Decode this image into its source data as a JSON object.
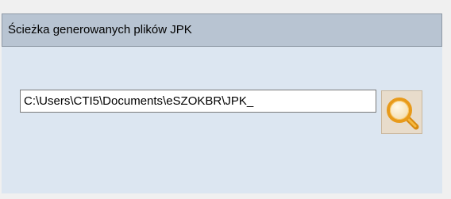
{
  "panel": {
    "title": "Ścieżka generowanych plików JPK"
  },
  "path_field": {
    "value": "C:\\Users\\CTI5\\Documents\\eSZOKBR\\JPK_"
  },
  "browse_button": {
    "icon": "magnifier-icon"
  },
  "colors": {
    "panel_background": "#dce6f1",
    "header_background": "#b8c4d2",
    "button_background": "#e8dccb",
    "icon_accent": "#f0a020"
  }
}
